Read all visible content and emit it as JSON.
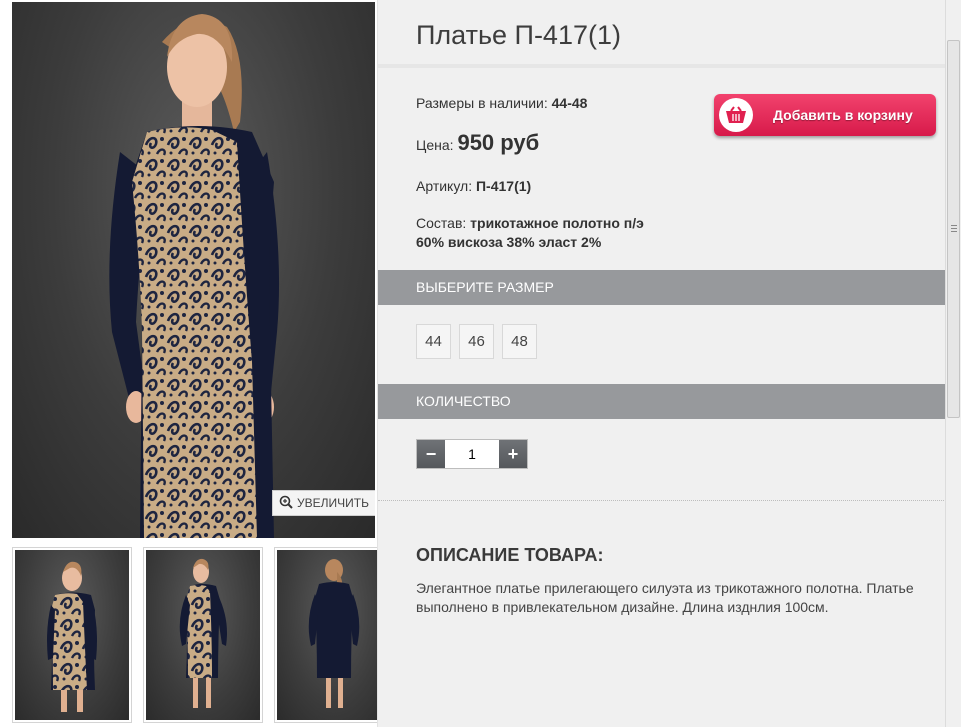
{
  "product": {
    "title": "Платье П-417(1)",
    "sizes_label": "Размеры в наличии:",
    "sizes_value": "44-48",
    "price_label": "Цена:",
    "price_value": "950 руб",
    "article_label": "Артикул:",
    "article_value": "П-417(1)",
    "composition_label": "Состав:",
    "composition_value_1": "трикотажное полотно п/э",
    "composition_value_2": "60% вискоза 38% эласт 2%"
  },
  "cart": {
    "button_label": "Добавить в корзину",
    "icon": "basket-icon"
  },
  "gallery": {
    "zoom_label": "УВЕЛИЧИТЬ",
    "zoom_icon": "magnifier-plus-icon",
    "thumbnails": [
      "front-view",
      "front-full-view",
      "back-view"
    ]
  },
  "size_section": {
    "heading": "ВЫБЕРИТЕ РАЗМЕР",
    "options": [
      "44",
      "46",
      "48"
    ]
  },
  "quantity_section": {
    "heading": "КОЛИЧЕСТВО",
    "value": "1",
    "minus": "−",
    "plus": "+"
  },
  "description": {
    "heading": "ОПИСАНИЕ ТОВАРА:",
    "text": "Элегантное платье прилегающего силуэта из трикотажного полотна. Платье выполнено в привлекательном дизайне. Длина изднлия 100см."
  },
  "colors": {
    "cart_button": "#e0204f",
    "section_header": "#97999c",
    "panel_bg": "#f0f0f0"
  }
}
